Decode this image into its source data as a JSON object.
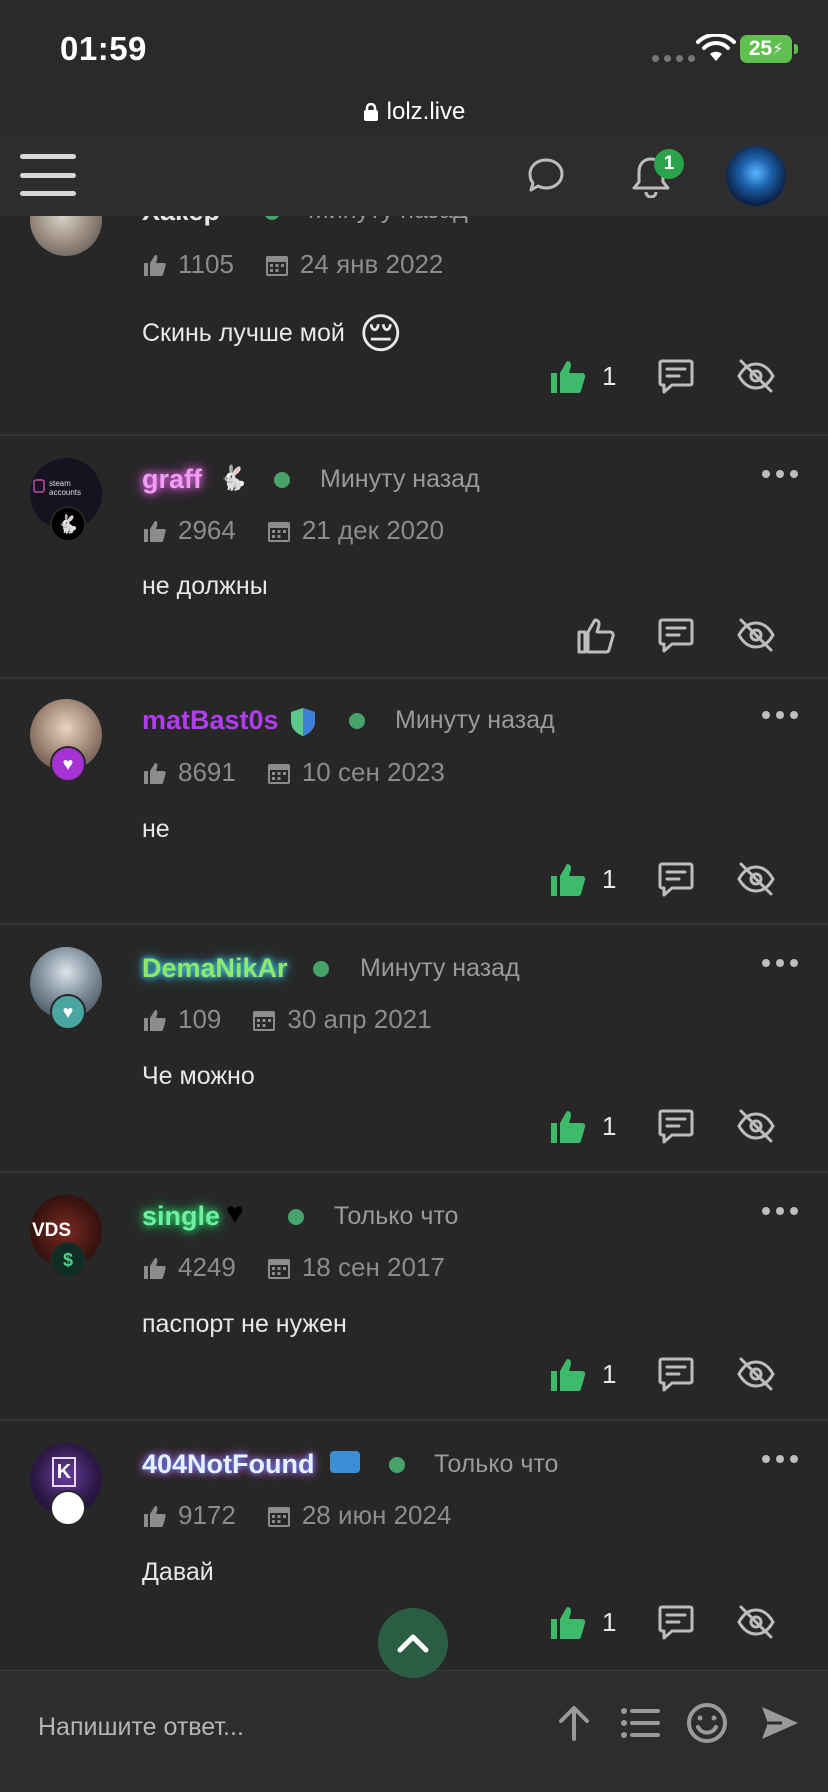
{
  "status": {
    "time": "01:59",
    "battery": "25"
  },
  "browser": {
    "url": "lolz.live"
  },
  "header": {
    "notifications_count": "1"
  },
  "posts": [
    {
      "username": "Хакер",
      "username_color": "#ffffff",
      "time": "Минуту назад",
      "likes": "1105",
      "date": "24 янв 2022",
      "text": "Скинь лучше мой",
      "emoji": "😔",
      "like_count": "1",
      "liked": true
    },
    {
      "username": "graff",
      "username_color": "#f19cf5",
      "time": "Минуту назад",
      "likes": "2964",
      "date": "21 дек 2020",
      "text": "не должны",
      "like_count": "",
      "liked": false
    },
    {
      "username": "matBast0s",
      "username_color": "#b23cf0",
      "time": "Минуту назад",
      "likes": "8691",
      "date": "10 сен 2023",
      "text": "не",
      "like_count": "1",
      "liked": true
    },
    {
      "username": "DemaNikAr",
      "username_color": "#8fe86a",
      "time": "Минуту назад",
      "likes": "109",
      "date": "30 апр 2021",
      "text": "Че можно",
      "like_count": "1",
      "liked": true
    },
    {
      "username": "single",
      "username_color": "#6ff0a0",
      "time": "Только что",
      "likes": "4249",
      "date": "18 сен 2017",
      "text": "паспорт не нужен",
      "like_count": "1",
      "liked": true
    },
    {
      "username": "404NotFound",
      "username_color": "#e6f2ff",
      "time": "Только что",
      "likes": "9172",
      "date": "28 июн 2024",
      "text": "Давай",
      "like_count": "1",
      "liked": true
    }
  ],
  "avatars": {
    "graff_logo_line1": "steam",
    "graff_logo_line2": "accounts",
    "single_logo": "VDS"
  },
  "composer": {
    "placeholder": "Напишите ответ..."
  },
  "colors": {
    "accent": "#47a36a",
    "like_active": "#3dbb6a",
    "background": "#272727"
  }
}
